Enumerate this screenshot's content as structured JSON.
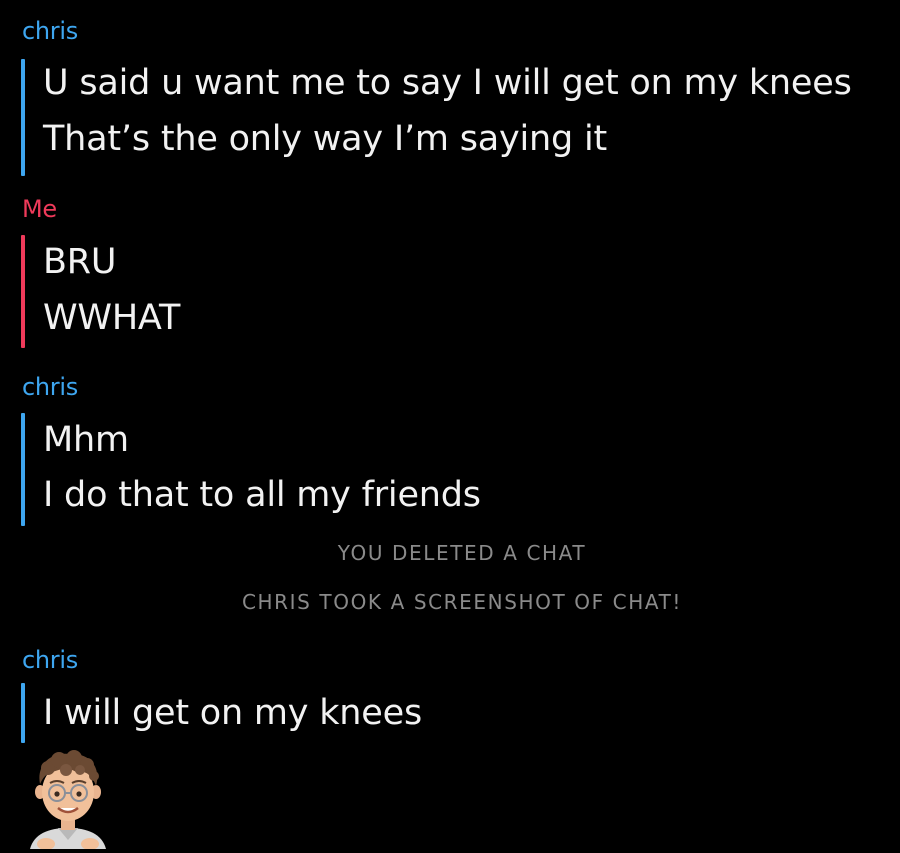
{
  "colors": {
    "friend": "#3ea6f0",
    "me": "#ef3a5a",
    "text": "#f2f2f2",
    "notice": "#8a8a8a",
    "background": "#000000"
  },
  "groups": [
    {
      "sender": "chris",
      "role": "friend",
      "messages": [
        "U said u want me to say I will get on my knees",
        "That’s the only way I’m saying it"
      ]
    },
    {
      "sender": "Me",
      "role": "me",
      "messages": [
        "BRU",
        "WWHAT"
      ]
    },
    {
      "sender": "chris",
      "role": "friend",
      "messages": [
        "Mhm",
        "I do that to all my friends"
      ]
    },
    {
      "sender": "chris",
      "role": "friend",
      "messages": [
        "I will get on my knees"
      ]
    }
  ],
  "notices": [
    "YOU DELETED A CHAT",
    "CHRIS TOOK A SCREENSHOT OF CHAT!"
  ],
  "avatar": {
    "icon": "bitmoji-avatar-icon"
  }
}
